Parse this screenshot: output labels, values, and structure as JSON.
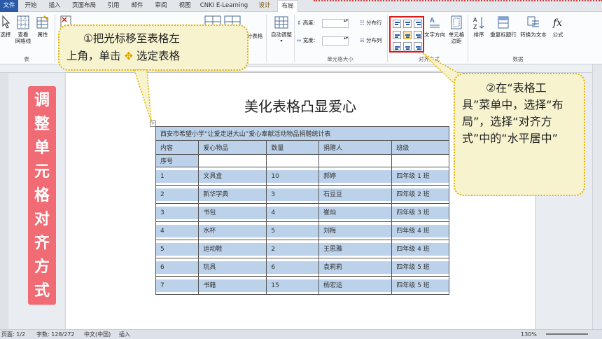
{
  "tabs": {
    "file": "文件",
    "items": [
      "开始",
      "插入",
      "页面布局",
      "引用",
      "邮件",
      "审阅",
      "视图",
      "CNKI E-Learning",
      "设计",
      "布局"
    ]
  },
  "ribbon": {
    "select_label": "选择",
    "gridlines_label": "查看\n网格线",
    "properties_label": "属性",
    "group_table": "表",
    "split_table": "分表格",
    "autofit": "自动调整",
    "height_label": "高度:",
    "width_label": "宽度:",
    "distribute_rows": "分布行",
    "distribute_cols": "分布列",
    "group_cellsize": "单元格大小",
    "text_direction": "文字方向",
    "cell_margins": "单元格\n边距",
    "group_alignment": "对齐方式",
    "sort": "排序",
    "repeat_header": "重复标题行",
    "convert_text": "转换为文本",
    "formula": "公式",
    "group_data": "数据"
  },
  "banner": {
    "text": "调整单元格对齐方式"
  },
  "callout1": {
    "line1": "①把光标移至表格左",
    "line2a": "上角，单击",
    "line2b": "选定表格"
  },
  "callout2": {
    "text1": "②在“表格工",
    "text2": "具”菜单中，选择“布局”，选择“对齐方式”中的“水平居中”"
  },
  "document": {
    "title": "美化表格凸显爱心",
    "table_title": "西安市希望小学“让爱走进大山”爱心奉献活动物品捐赠统计表",
    "headers": [
      "内容",
      "爱心物品",
      "数量",
      "捐赠人",
      "班级"
    ],
    "header2": "序号",
    "rows": [
      [
        "1",
        "文具盒",
        "10",
        "郝婷",
        "四年级 1 班"
      ],
      [
        "2",
        "新华字典",
        "3",
        "石豆豆",
        "四年级 2 班"
      ],
      [
        "3",
        "书包",
        "4",
        "崔灿",
        "四年级 3 班"
      ],
      [
        "4",
        "水杯",
        "5",
        "刘梅",
        "四年级 4 班"
      ],
      [
        "5",
        "运动鞋",
        "2",
        "王思雅",
        "四年级 4 班"
      ],
      [
        "6",
        "玩具",
        "6",
        "袁莉莉",
        "四年级 5 班"
      ],
      [
        "7",
        "书籍",
        "15",
        "杨宏运",
        "四年级 5 班"
      ]
    ]
  },
  "status": {
    "page": "页面: 1/2",
    "words": "字数: 128/272",
    "lang": "中文(中国)",
    "insert": "插入",
    "zoom": "130%"
  }
}
